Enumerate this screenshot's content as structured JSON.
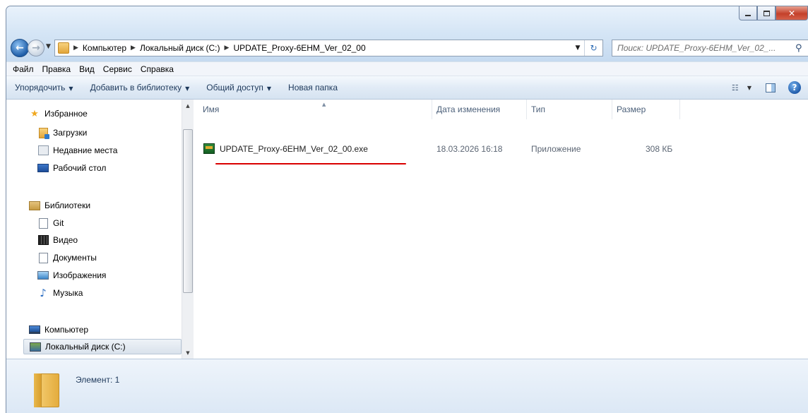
{
  "address": {
    "crumbs": [
      "Компьютер",
      "Локальный диск (C:)",
      "UPDATE_Proxy-6EHM_Ver_02_00"
    ]
  },
  "search": {
    "placeholder": "Поиск: UPDATE_Proxy-6EHM_Ver_02_..."
  },
  "menu": [
    "Файл",
    "Правка",
    "Вид",
    "Сервис",
    "Справка"
  ],
  "toolbar": {
    "organize": "Упорядочить",
    "add_library": "Добавить в библиотеку",
    "share": "Общий доступ",
    "new_folder": "Новая папка"
  },
  "nav": {
    "favorites": "Избранное",
    "downloads": "Загрузки",
    "recent": "Недавние места",
    "desktop": "Рабочий стол",
    "libraries": "Библиотеки",
    "git": "Git",
    "video": "Видео",
    "documents": "Документы",
    "images": "Изображения",
    "music": "Музыка",
    "computer": "Компьютер",
    "local_disk": "Локальный диск (C:)"
  },
  "columns": {
    "name": "Имя",
    "date": "Дата изменения",
    "type": "Тип",
    "size": "Размер"
  },
  "files": [
    {
      "name": "UPDATE_Proxy-6EHM_Ver_02_00.exe",
      "date": "18.03.2026 16:18",
      "type": "Приложение",
      "size": "308 КБ"
    }
  ],
  "details": {
    "count_text": "Элемент: 1"
  },
  "colors": {
    "highlight_underline": "#d90000",
    "accent": "#1e395b"
  }
}
